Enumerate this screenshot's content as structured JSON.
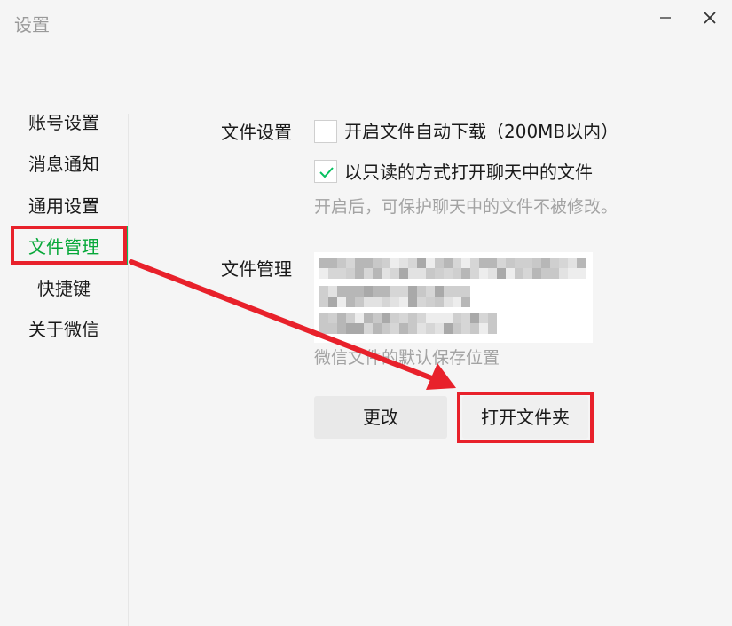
{
  "window": {
    "title": "设置",
    "minimize_icon": "minimize-icon",
    "close_icon": "close-icon"
  },
  "sidebar": {
    "items": [
      {
        "label": "账号设置",
        "active": false
      },
      {
        "label": "消息通知",
        "active": false
      },
      {
        "label": "通用设置",
        "active": false
      },
      {
        "label": "文件管理",
        "active": true
      },
      {
        "label": "快捷键",
        "active": false
      },
      {
        "label": "关于微信",
        "active": false
      }
    ],
    "accent_color": "#07c160"
  },
  "file_settings": {
    "label": "文件设置",
    "options": [
      {
        "label": "开启文件自动下载（200MB以内）",
        "checked": false
      },
      {
        "label": "以只读的方式打开聊天中的文件",
        "checked": true
      }
    ],
    "hint": "开启后，可保护聊天中的文件不被修改。"
  },
  "file_management": {
    "label": "文件管理",
    "path_hint": "微信文件的默认保存位置",
    "change_button": "更改",
    "open_folder_button": "打开文件夹"
  },
  "annotation": {
    "color": "#e8212b"
  }
}
